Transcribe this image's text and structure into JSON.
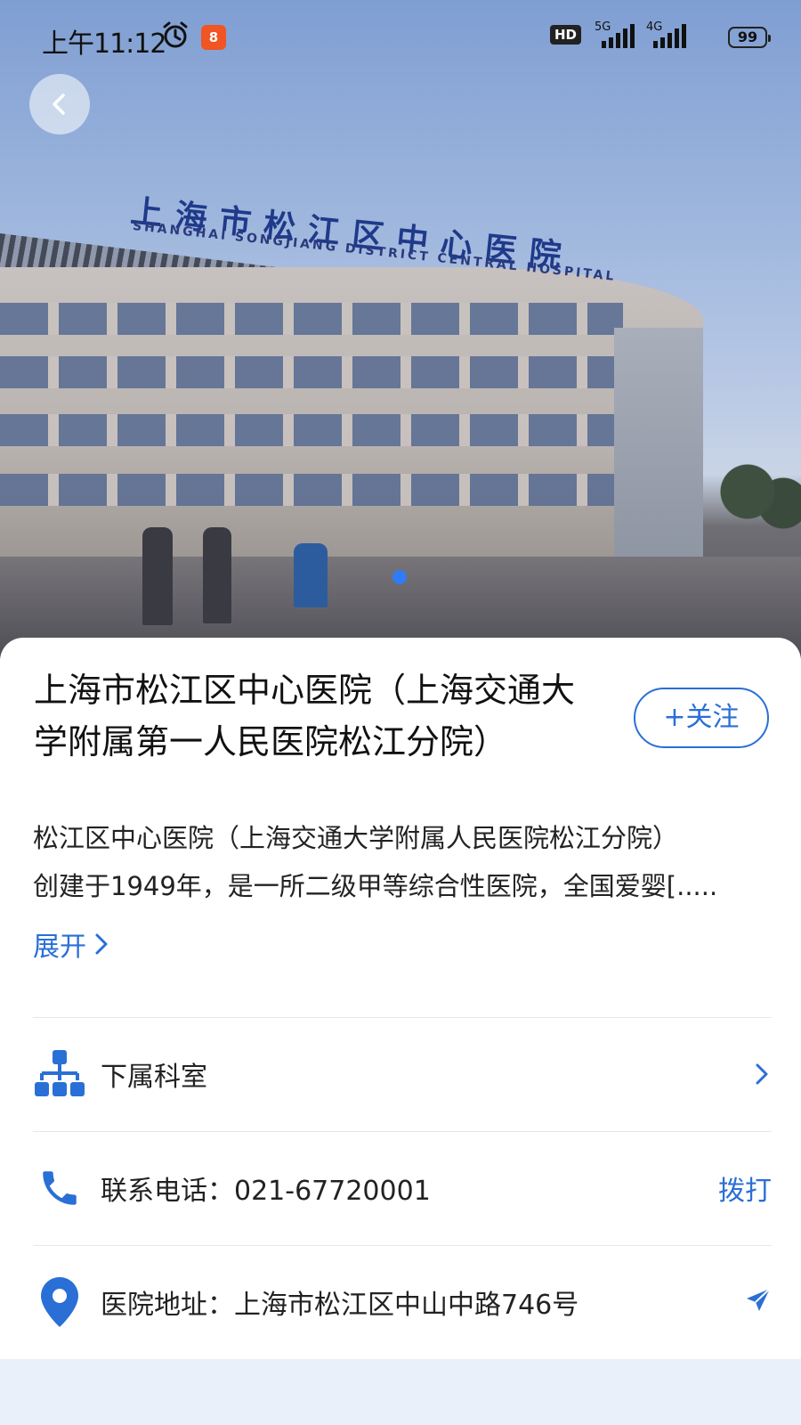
{
  "status_bar": {
    "time": "上午11:12",
    "app_badge": "8",
    "hd": "HD",
    "net1": "5G",
    "net2": "4G",
    "battery": "99"
  },
  "hero": {
    "sign_cn": "上海市松江区中心医院",
    "sign_en": "SHANGHAI SONGJIANG DISTRICT CENTRAL HOSPITAL",
    "page_indicator": {
      "current": 1,
      "total": 1
    }
  },
  "hospital": {
    "name": "上海市松江区中心医院（上海交通大学附属第一人民医院松江分院）",
    "follow_label": "+关注",
    "description_line1": "松江区中心医院（上海交通大学附属人民医院松江分院）",
    "description_line2": "创建于1949年，是一所二级甲等综合性医院，全国爱婴[.....",
    "expand_label": "展开"
  },
  "rows": {
    "departments": {
      "label": "下属科室",
      "icon": "org-chart-icon"
    },
    "phone": {
      "label": "联系电话：021-67720001",
      "action": "拨打",
      "icon": "phone-icon"
    },
    "address": {
      "label": "医院地址：上海市松江区中山中路746号",
      "icon": "location-pin-icon",
      "action_icon": "navigate-icon"
    }
  },
  "colors": {
    "accent": "#2a6fd6",
    "indicator": "#2f7cf6"
  }
}
